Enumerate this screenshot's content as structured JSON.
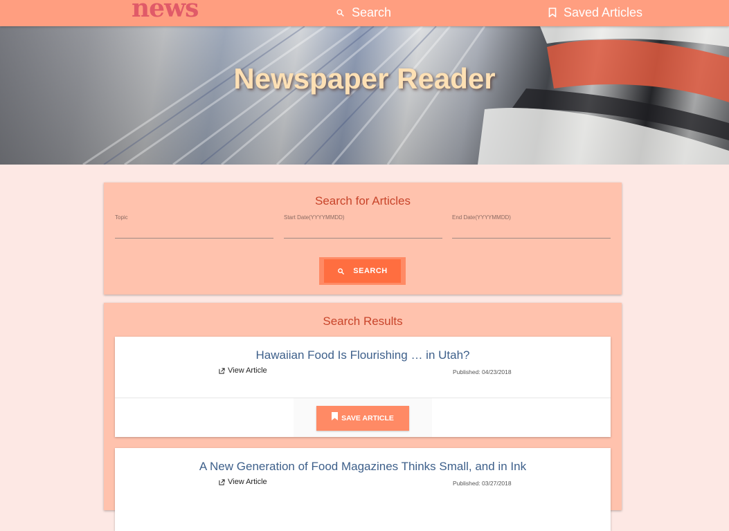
{
  "nav": {
    "logo": "news",
    "search_label": "Search",
    "saved_label": "Saved Articles"
  },
  "hero": {
    "title": "Newspaper Reader"
  },
  "search": {
    "title": "Search for Articles",
    "topic_label": "Topic",
    "start_label": "Start Date(YYYYMMDD)",
    "end_label": "End Date(YYYYMMDD)",
    "button_label": "SEARCH"
  },
  "results": {
    "title": "Search Results",
    "articles": [
      {
        "headline": "Hawaiian Food Is Flourishing … in Utah?",
        "link_label": "View Article",
        "published": "Published: 04/23/2018",
        "save_label": "SAVE ARTICLE"
      },
      {
        "headline": "A New Generation of Food Magazines Thinks Small, and in Ink",
        "link_label": "View Article",
        "published": "Published: 03/27/2018"
      }
    ]
  },
  "colors": {
    "nav_bg": "#ff9e80",
    "page_bg": "#fde8e4",
    "panel_bg": "#ffc2ad",
    "accent": "#ff6e40",
    "title_red": "#c8442a",
    "headline_blue": "#3d5f8a"
  }
}
